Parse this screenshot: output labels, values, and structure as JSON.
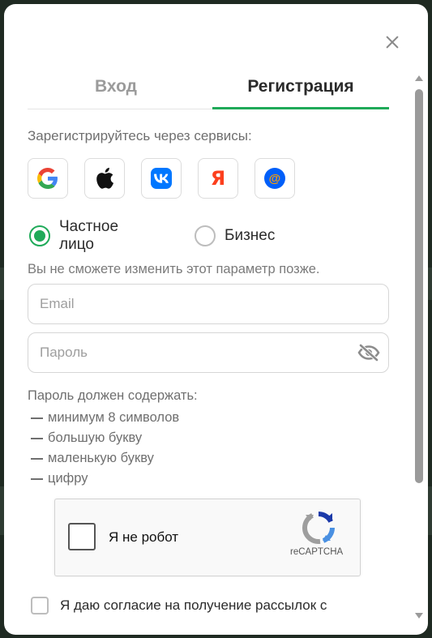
{
  "tabs": [
    {
      "label": "Вход",
      "active": false
    },
    {
      "label": "Регистрация",
      "active": true
    }
  ],
  "services": {
    "title": "Зарегистрируйтесь через сервисы:",
    "items": [
      {
        "icon": "google-icon"
      },
      {
        "icon": "apple-icon"
      },
      {
        "icon": "vk-icon"
      },
      {
        "icon": "yandex-icon",
        "glyph": "Я"
      },
      {
        "icon": "mailru-icon",
        "glyph": "@"
      }
    ]
  },
  "account_type": {
    "options": [
      {
        "label": "Частное лицо",
        "selected": true
      },
      {
        "label": "Бизнес",
        "selected": false
      }
    ],
    "hint": "Вы не сможете изменить этот параметр позже."
  },
  "form": {
    "email_placeholder": "Email",
    "password_placeholder": "Пароль"
  },
  "password_rules": {
    "title": "Пароль должен содержать:",
    "items": [
      "минимум 8 символов",
      "большую букву",
      "маленькую букву",
      "цифру"
    ]
  },
  "captcha": {
    "label": "Я не робот",
    "brand": "reCAPTCHA"
  },
  "consent": {
    "text": "Я даю согласие на получение рассылок с"
  },
  "colors": {
    "accent": "#1faa59",
    "vk": "#0077ff",
    "yandex": "#fc3f1d",
    "mailru": "#005ff9"
  }
}
